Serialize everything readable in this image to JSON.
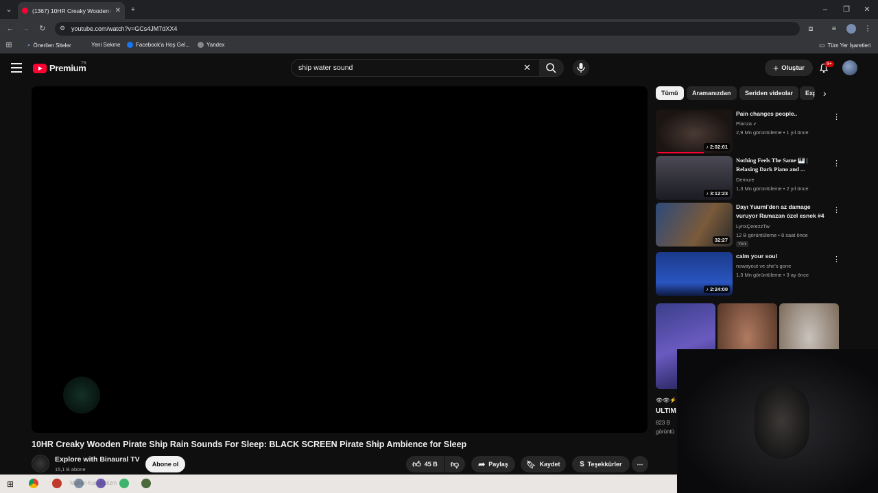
{
  "browser": {
    "tab_title": "(1367) 10HR Creaky Wooden Pi",
    "url": "youtube.com/watch?v=GCs4JM7dXX4",
    "bookmarks": [
      "Önerilen Siteler",
      "Yeni Sekme",
      "Facebook'a Hoş Gel...",
      "Yandex"
    ],
    "all_bookmarks": "Tüm Yer İşaretleri"
  },
  "header": {
    "logo": "Premium",
    "logo_region": "TR",
    "search_value": "ship water sound",
    "create_label": "Oluştur",
    "notif_count": "9+"
  },
  "video": {
    "title": "10HR Creaky Wooden Pirate Ship Rain Sounds For Sleep: BLACK SCREEN Pirate Ship Ambience for Sleep",
    "channel": "Explore with Binaural TV",
    "subscribers": "15,1 B abone",
    "subscribe_label": "Abone ol",
    "likes": "45 B",
    "share_label": "Paylaş",
    "save_label": "Kaydet",
    "thanks_label": "Teşekkürler"
  },
  "chips": [
    "Tümü",
    "Aramanızdan",
    "Seriden videolar",
    "Exp"
  ],
  "related": [
    {
      "title": "Pain changes people..",
      "channel": "Pianza",
      "meta": "2,9 Mn görüntüleme • 1 yıl önce",
      "duration": "2:02:01"
    },
    {
      "title": "Nothing Feels The Same 🎹 | Relaxing Dark Piano and ...",
      "channel": "Demure",
      "meta": "1,3 Mn görüntüleme • 2 yıl önce",
      "duration": "3:12:23"
    },
    {
      "title": "Dayı Yuumi'den az damage vuruyor Ramazan özel esnek #4",
      "channel": "LynxÇerezzTw",
      "meta": "12 B görüntüleme • 8 saat önce",
      "duration": "32:27",
      "badge": "Yeni"
    },
    {
      "title": "calm your soul",
      "channel": "nowayout ve she's gone",
      "meta": "1,3 Mn görüntüleme • 3 ay önce",
      "duration": "2:24:00"
    }
  ],
  "shorts_strip": {
    "icons": "👁👁⚡",
    "title": "ULTIM",
    "views": "823 B",
    "sub": "görüntü"
  },
  "taskbar_text": "Muhan Karalkolizm"
}
